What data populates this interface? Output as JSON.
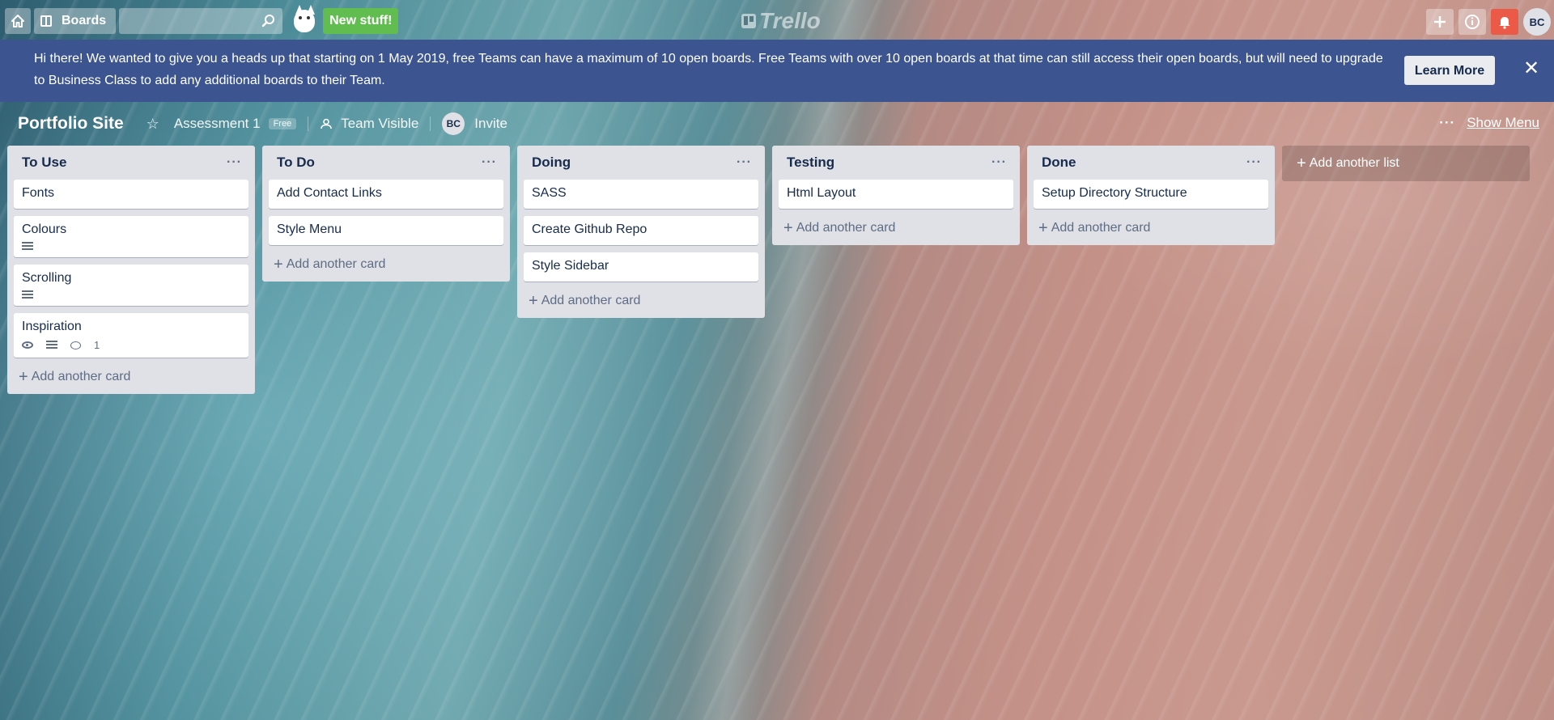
{
  "header": {
    "boards_label": "Boards",
    "new_stuff_label": "New stuff!",
    "logo_text": "Trello",
    "avatar_initials": "BC"
  },
  "banner": {
    "message": "Hi there! We wanted to give you a heads up that starting on 1 May 2019, free Teams can have a maximum of 10 open boards. Free Teams with over 10 open boards at that time can still access their open boards, but will need to upgrade to Business Class to add any additional boards to their Team.",
    "learn_more_label": "Learn More",
    "close_glyph": "✕"
  },
  "board": {
    "title": "Portfolio Site",
    "team_name": "Assessment 1",
    "plan_badge": "Free",
    "visibility": "Team Visible",
    "member_initials": "BC",
    "invite_label": "Invite",
    "show_menu_label": "Show Menu"
  },
  "lists": [
    {
      "title": "To Use",
      "cards": [
        "Fonts",
        "Colours",
        "Scrolling",
        "Inspiration"
      ],
      "add_card_label": "Add another card"
    },
    {
      "title": "To Do",
      "cards": [
        "Add Contact Links",
        "Style Menu"
      ],
      "add_card_label": "Add another card"
    },
    {
      "title": "Doing",
      "cards": [
        "SASS",
        "Create Github Repo",
        "Style Sidebar"
      ],
      "add_card_label": "Add another card"
    },
    {
      "title": "Testing",
      "cards": [
        "Html Layout"
      ],
      "add_card_label": "Add another card"
    },
    {
      "title": "Done",
      "cards": [
        "Setup Directory Structure"
      ],
      "add_card_label": "Add another card"
    }
  ],
  "card_badges": {
    "inspiration_comment_count": "1"
  },
  "add_list_label": "Add another list",
  "colors": {
    "banner": "#3c5591",
    "new_stuff": "#61bd4f",
    "notification": "#eb5a46",
    "list_bg": "#dfe1e6"
  },
  "icons": [
    "home-icon",
    "boards-icon",
    "search-icon",
    "taco-mascot-icon",
    "trello-logo-icon",
    "plus-icon",
    "info-icon",
    "bell-icon",
    "close-icon",
    "star-icon",
    "team-icon",
    "ellipsis-icon",
    "description-icon",
    "eye-icon",
    "comment-icon"
  ]
}
